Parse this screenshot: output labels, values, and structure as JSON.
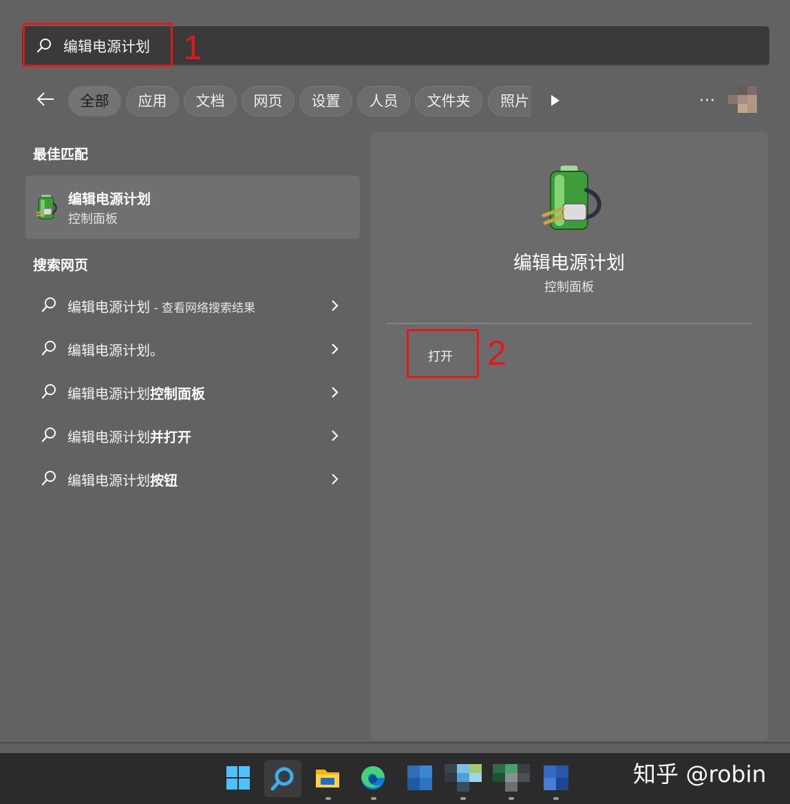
{
  "search": {
    "query": "编辑电源计划"
  },
  "annotations": {
    "first": "1",
    "second": "2",
    "color": "#e01a1a"
  },
  "filters": [
    {
      "label": "全部",
      "active": true
    },
    {
      "label": "应用"
    },
    {
      "label": "文档"
    },
    {
      "label": "网页"
    },
    {
      "label": "设置"
    },
    {
      "label": "人员"
    },
    {
      "label": "文件夹"
    },
    {
      "label": "照片"
    }
  ],
  "more_label": "···",
  "best_match": {
    "section_title": "最佳匹配",
    "name": "编辑电源计划",
    "category": "控制面板",
    "icon": "battery-plug-icon"
  },
  "web_search": {
    "section_title": "搜索网页",
    "items": [
      {
        "prefix": "编辑电源计划",
        "bold": "",
        "suffix": " - 查看网络搜索结果"
      },
      {
        "prefix": "编辑电源计划。",
        "bold": "",
        "suffix": ""
      },
      {
        "prefix": "编辑电源计划",
        "bold": "控制面板",
        "suffix": ""
      },
      {
        "prefix": "编辑电源计划",
        "bold": "并打开",
        "suffix": ""
      },
      {
        "prefix": "编辑电源计划",
        "bold": "按钮",
        "suffix": ""
      }
    ]
  },
  "detail": {
    "title": "编辑电源计划",
    "subtitle": "控制面板",
    "action_open": "打开"
  },
  "taskbar": {
    "icons": [
      "windows-start-icon",
      "search-icon",
      "file-explorer-icon",
      "edge-browser-icon",
      "app-icon",
      "app-icon",
      "app-icon",
      "app-icon"
    ]
  },
  "watermark": "知乎 @robin"
}
